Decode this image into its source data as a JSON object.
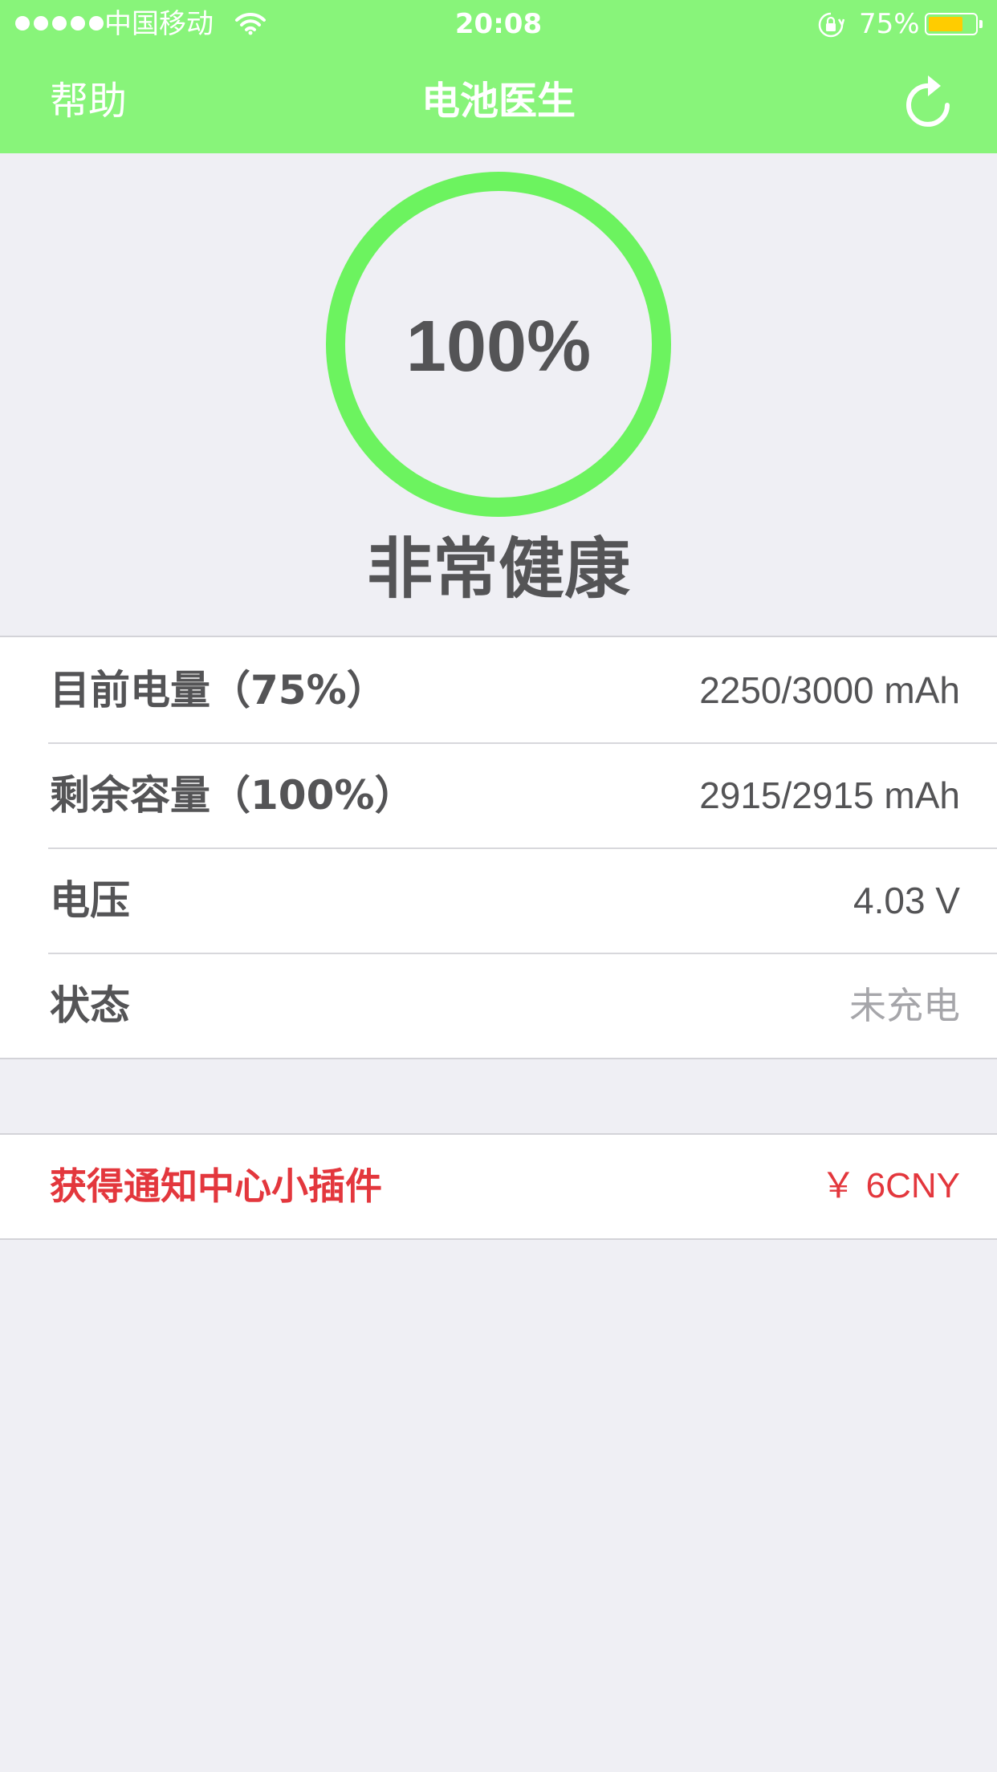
{
  "status_bar": {
    "carrier": "中国移动",
    "time": "20:08",
    "battery_percent": "75%",
    "battery_level": 0.75,
    "battery_color": "#ffcc00"
  },
  "nav": {
    "help_label": "帮助",
    "title": "电池医生",
    "refresh_icon": "refresh-icon",
    "background_color": "#88f47a"
  },
  "health": {
    "percent_text": "100%",
    "percent_value": 100,
    "ring_color": "#6cf35f",
    "label": "非常健康"
  },
  "info": {
    "rows": [
      {
        "label": "目前电量（75%）",
        "value": "2250/3000 mAh"
      },
      {
        "label": "剩余容量（100%）",
        "value": "2915/2915 mAh"
      },
      {
        "label": "电压",
        "value": "4.03 V"
      },
      {
        "label": "状态",
        "value": "未充电"
      }
    ]
  },
  "widget": {
    "label": "获得通知中心小插件",
    "price": "￥ 6CNY",
    "color": "#e3373d"
  }
}
